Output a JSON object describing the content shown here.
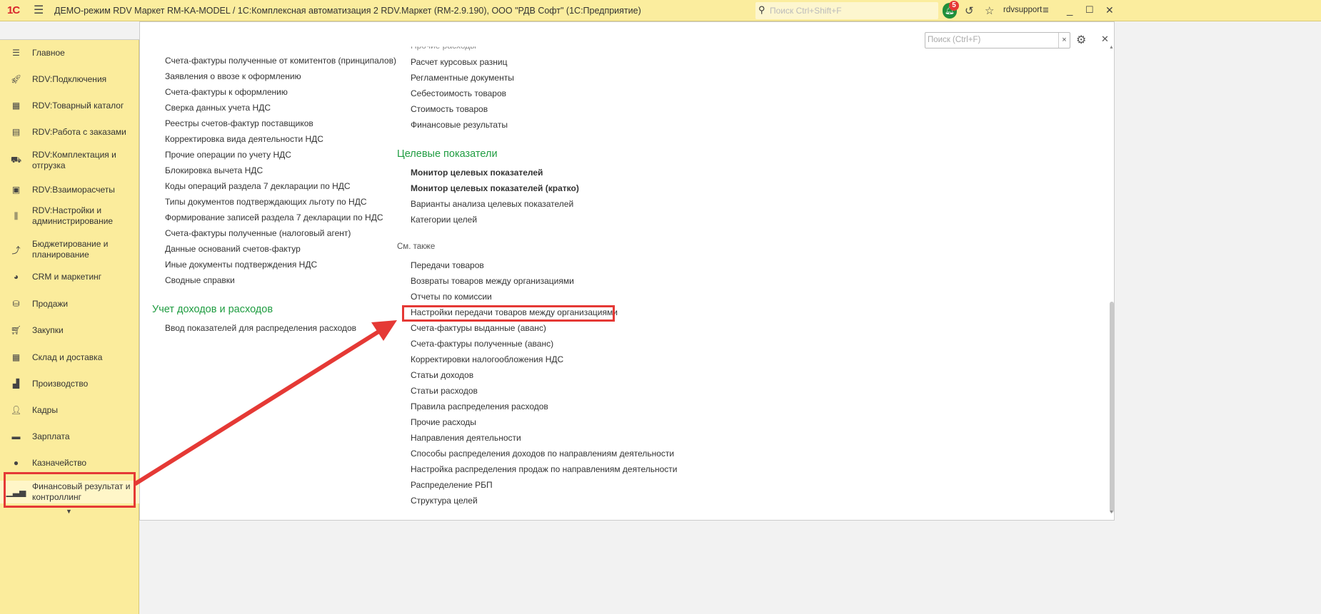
{
  "titlebar": {
    "title": "ДЕМО-режим RDV Маркет RM-KA-MODEL / 1С:Комплексная автоматизация 2 RDV.Маркет (RM-2.9.190), ООО \"РДВ Софт\"  (1С:Предприятие)",
    "logo": "1С",
    "search_placeholder": "Поиск Ctrl+Shift+F",
    "notifications_count": "5",
    "user": "rdvsupport"
  },
  "sidebar": {
    "items": [
      {
        "label": "Главное",
        "icon": "menu-icon"
      },
      {
        "label": "RDV:Подключения",
        "icon": "rocket-icon"
      },
      {
        "label": "RDV:Товарный каталог",
        "icon": "grid-icon"
      },
      {
        "label": "RDV:Работа с заказами",
        "icon": "orders-icon"
      },
      {
        "label": "RDV:Комплектация и отгрузка",
        "icon": "cart-icon"
      },
      {
        "label": "RDV:Взаиморасчеты",
        "icon": "calculator-icon"
      },
      {
        "label": "RDV:Настройки и администрирование",
        "icon": "sliders-icon"
      },
      {
        "label": "Бюджетирование и планирование",
        "icon": "chart-icon"
      },
      {
        "label": "CRM и маркетинг",
        "icon": "pie-icon"
      },
      {
        "label": "Продажи",
        "icon": "bag-icon"
      },
      {
        "label": "Закупки",
        "icon": "cart-icon"
      },
      {
        "label": "Склад и доставка",
        "icon": "warehouse-icon"
      },
      {
        "label": "Производство",
        "icon": "factory-icon"
      },
      {
        "label": "Кадры",
        "icon": "person-icon"
      },
      {
        "label": "Зарплата",
        "icon": "card-icon"
      },
      {
        "label": "Казначейство",
        "icon": "coin-icon"
      },
      {
        "label": "Финансовый результат и контроллинг",
        "icon": "bar-chart-icon"
      }
    ]
  },
  "content": {
    "search_placeholder": "Поиск (Ctrl+F)",
    "left_items": [
      "Счета-фактуры полученные от комитентов (принципалов)",
      "Заявления о ввозе к оформлению",
      "Счета-фактуры к оформлению",
      "Сверка данных учета НДС",
      "Реестры счетов-фактур поставщиков",
      "Корректировка вида деятельности НДС",
      "Прочие операции по учету НДС",
      "Блокировка вычета НДС",
      "Коды операций раздела 7 декларации по НДС",
      "Типы документов подтверждающих льготу по НДС",
      "Формирование записей раздела 7 декларации по НДС",
      "Счета-фактуры полученные (налоговый агент)",
      "Данные оснований счетов-фактур",
      "Иные документы подтверждения НДС",
      "Сводные справки"
    ],
    "left_section2": {
      "title": "Учет доходов и расходов",
      "items": [
        "Ввод показателей для распределения расходов"
      ]
    },
    "right_top_cut": "Прочие расходы",
    "right_items": [
      "Расчет курсовых разниц",
      "Регламентные документы",
      "Себестоимость товаров",
      "Стоимость товаров",
      "Финансовые результаты"
    ],
    "targets": {
      "title": "Целевые показатели",
      "bold_items": [
        "Монитор целевых показателей",
        "Монитор целевых показателей (кратко)"
      ],
      "items": [
        "Варианты анализа целевых показателей",
        "Категории целей"
      ]
    },
    "see_also": {
      "title": "См. также",
      "items": [
        "Передачи товаров",
        "Возвраты товаров между организациями",
        "Отчеты по комиссии",
        "Настройки передачи товаров между организациями",
        "Счета-фактуры выданные (аванс)",
        "Счета-фактуры полученные (аванс)",
        "Корректировки налогообложения НДС",
        "Статьи доходов",
        "Статьи расходов",
        "Правила распределения расходов",
        "Прочие расходы",
        "Направления деятельности",
        "Способы распределения доходов по направлениям деятельности",
        "Настройка распределения продаж по направлениям деятельности",
        "Распределение РБП",
        "Структура целей"
      ]
    }
  },
  "colors": {
    "accent": "#e53935",
    "section": "#1e9c40",
    "sidebar": "#fbec9c"
  }
}
